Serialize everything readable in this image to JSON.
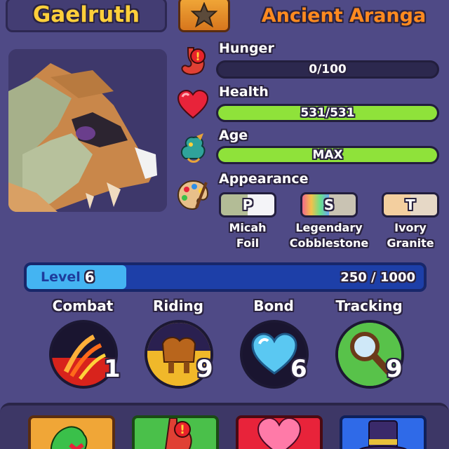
{
  "pet": {
    "name": "Gaelruth",
    "species": "Ancient Aranga"
  },
  "stats": {
    "hunger": {
      "label": "Hunger",
      "text": "0/100",
      "value": 0,
      "max": 100
    },
    "health": {
      "label": "Health",
      "text": "531/531",
      "value": 531,
      "max": 531
    },
    "age": {
      "label": "Age",
      "text": "MAX",
      "fraction": 1.0
    }
  },
  "appearance": {
    "label": "Appearance",
    "items": [
      {
        "letter": "P",
        "line1": "Micah",
        "line2": "Foil"
      },
      {
        "letter": "S",
        "line1": "Legendary",
        "line2": "Cobblestone"
      },
      {
        "letter": "T",
        "line1": "Ivory",
        "line2": "Granite"
      }
    ]
  },
  "level": {
    "label": "Level",
    "number": "6",
    "xp_text": "250 / 1000",
    "xp": 250,
    "xp_max": 1000
  },
  "skills": [
    {
      "label": "Combat",
      "value": "1"
    },
    {
      "label": "Riding",
      "value": "9"
    },
    {
      "label": "Bond",
      "value": "6"
    },
    {
      "label": "Tracking",
      "value": "9"
    }
  ],
  "colors": {
    "name": "#ffcf3a",
    "species": "#ff8a1f",
    "health_bar": "#8fe23a",
    "age_bar": "#8fe23a",
    "level_fill": "#44b4f2"
  },
  "icons": {
    "favorite": "star-icon",
    "hunger": "stomach-icon",
    "health": "heart-icon",
    "age": "dragon-age-icon",
    "appearance": "paint-palette-icon",
    "combat": "claw-slash-icon",
    "riding": "saddle-icon",
    "bond": "blue-heart-icon",
    "tracking": "magnifier-icon"
  }
}
